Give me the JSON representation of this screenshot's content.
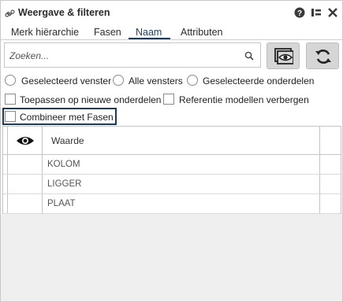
{
  "window": {
    "title": "Weergave & filteren",
    "accent_color": "#1c3a5e",
    "icons": [
      "link-icon",
      "help-icon",
      "pin-icon",
      "close-icon"
    ]
  },
  "tabs": [
    {
      "label": "Merk hiërarchie",
      "active": false
    },
    {
      "label": "Fasen",
      "active": false
    },
    {
      "label": "Naam",
      "active": true
    },
    {
      "label": "Attributen",
      "active": false
    }
  ],
  "search": {
    "placeholder": "Zoeken...",
    "value": ""
  },
  "buttons": {
    "view_icon": "view-icon",
    "refresh_icon": "refresh-icon"
  },
  "scope_options": [
    {
      "label": "Geselecteerd venster",
      "selected": false
    },
    {
      "label": "Alle vensters",
      "selected": false
    },
    {
      "label": "Geselecteerde onderdelen",
      "selected": false
    }
  ],
  "checkboxes": {
    "apply_new": {
      "label": "Toepassen op nieuwe onderdelen",
      "checked": false
    },
    "hide_ref": {
      "label": "Referentie modellen verbergen",
      "checked": false
    },
    "combine": {
      "label": "Combineer met Fasen",
      "checked": false
    }
  },
  "table": {
    "header_icon": "eye-icon",
    "header": "Waarde",
    "rows": [
      {
        "value": "KOLOM"
      },
      {
        "value": "LIGGER"
      },
      {
        "value": "PLAAT"
      }
    ]
  }
}
